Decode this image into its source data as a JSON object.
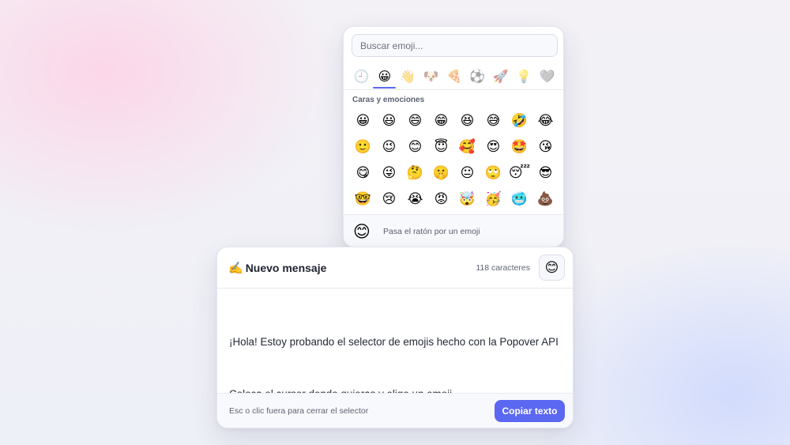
{
  "picker": {
    "search_placeholder": "Buscar emoji...",
    "categories": [
      {
        "icon": "🕘",
        "name": "recent"
      },
      {
        "icon": "😀",
        "name": "faces"
      },
      {
        "icon": "👋",
        "name": "people"
      },
      {
        "icon": "🐶",
        "name": "animals"
      },
      {
        "icon": "🍕",
        "name": "food"
      },
      {
        "icon": "⚽",
        "name": "activities"
      },
      {
        "icon": "🚀",
        "name": "travel"
      },
      {
        "icon": "💡",
        "name": "objects"
      },
      {
        "icon": "🩶",
        "name": "symbols"
      }
    ],
    "active_category": 1,
    "section_label": "Caras y emociones",
    "emojis": [
      "😀",
      "😃",
      "😄",
      "😁",
      "😆",
      "😅",
      "🤣",
      "😂",
      "🙂",
      "😉",
      "😊",
      "😇",
      "🥰",
      "😍",
      "🤩",
      "😘",
      "😋",
      "😜",
      "🤔",
      "🤫",
      "😐",
      "🙄",
      "😴",
      "😎",
      "🤓",
      "😢",
      "😭",
      "😡",
      "🤯",
      "🥳",
      "🥶",
      "💩"
    ],
    "preview_emoji": "😊",
    "preview_text": "Pasa el ratón por un emoji"
  },
  "card": {
    "title_icon": "✍️",
    "title": "Nuevo mensaje",
    "counter": "118 caracteres",
    "emoji_button_icon": "😊",
    "message_lines": [
      "¡Hola! Estoy probando el selector de emojis hecho con la Popover API",
      "Coloca el cursor donde quieras y elige un emoji."
    ],
    "hint": "Esc o clic fuera para cerrar el selector",
    "copy_label": "Copiar texto"
  },
  "colors": {
    "accent": "#5b68f1",
    "text": "#252a36",
    "muted": "#5f6473"
  }
}
